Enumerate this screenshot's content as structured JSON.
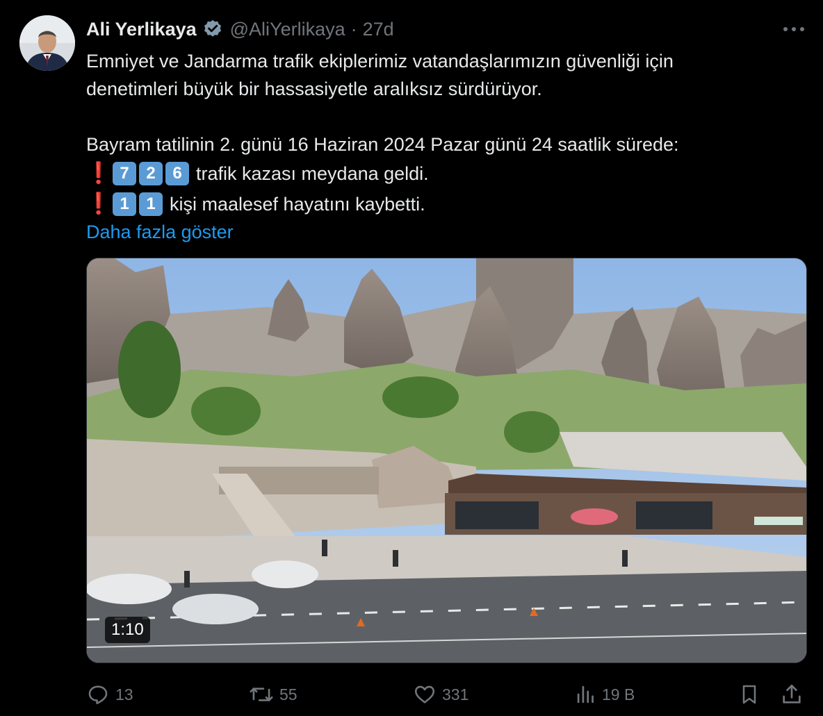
{
  "author": {
    "display_name": "Ali Yerlikaya",
    "handle": "@AliYerlikaya",
    "separator": "·",
    "time": "27d"
  },
  "tweet": {
    "line1": "Emniyet ve Jandarma trafik ekiplerimiz vatandaşlarımızın güvenliği için",
    "line2": "denetimleri büyük bir hassasiyetle aralıksız sürdürüyor.",
    "line3": "Bayram tatilinin 2. günü 16 Haziran 2024 Pazar günü 24 saatlik sürede:",
    "stat1": {
      "mark": "❗",
      "digits": [
        "7",
        "2",
        "6"
      ],
      "text": "trafik kazası meydana geldi."
    },
    "stat2": {
      "mark": "❗",
      "digits": [
        "1",
        "1"
      ],
      "text": "kişi maalesef hayatını kaybetti."
    },
    "show_more": "Daha fazla göster"
  },
  "media": {
    "duration": "1:10"
  },
  "actions": {
    "replies": "13",
    "reposts": "55",
    "likes": "331",
    "views": "19 B"
  },
  "colors": {
    "background": "#000000",
    "text": "#e7e9ea",
    "muted": "#71767b",
    "link": "#1d9bf0",
    "verified_badge": "#829aab",
    "keycap": "#5b9bd5",
    "exclamation": "#e3232f"
  },
  "icons": {
    "verified": "verified-badge-icon",
    "more": "more-dots-icon",
    "reply": "reply-icon",
    "repost": "repost-icon",
    "like": "heart-icon",
    "views": "views-chart-icon",
    "bookmark": "bookmark-icon",
    "share": "share-icon"
  }
}
